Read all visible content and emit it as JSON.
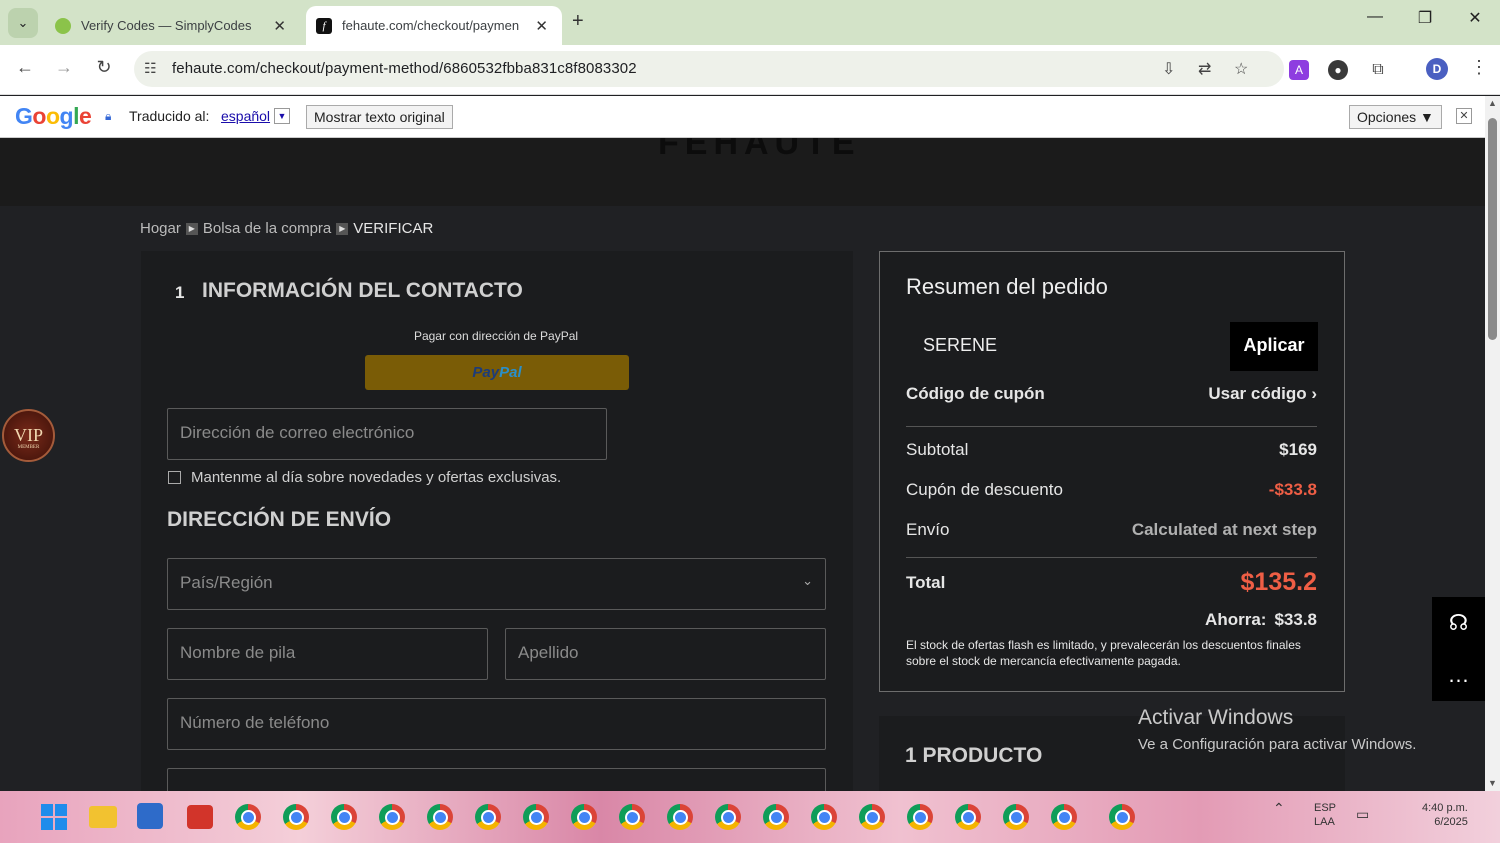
{
  "browser": {
    "tabs": [
      {
        "title": "Verify Codes — SimplyCodes",
        "active": false
      },
      {
        "title": "fehaute.com/checkout/paymen",
        "active": true
      }
    ],
    "url": "fehaute.com/checkout/payment-method/6860532fbba831c8f8083302",
    "profile_initial": "D"
  },
  "translate_bar": {
    "logo": "Google",
    "translated_to_label": "Traducido al:",
    "language": "español",
    "show_original_label": "Mostrar texto original",
    "options_label": "Opciones ▼"
  },
  "page": {
    "brand": "FEHAUTE",
    "breadcrumb": [
      "Hogar",
      "Bolsa de la compra",
      "VERIFICAR"
    ],
    "contact": {
      "step_number": "1",
      "title": "INFORMACIÓN DEL CONTACTO",
      "paypal_label": "Pagar con dirección de PayPal",
      "paypal_button_1": "Pay",
      "paypal_button_2": "Pal",
      "email_placeholder": "Dirección de correo electrónico",
      "newsletter_label": "Mantenme al día sobre novedades y ofertas exclusivas."
    },
    "shipping": {
      "title": "DIRECCIÓN DE ENVÍO",
      "country_placeholder": "País/Región",
      "first_name_placeholder": "Nombre de pila",
      "last_name_placeholder": "Apellido",
      "phone_placeholder": "Número de teléfono"
    },
    "vip_badge": {
      "title": "VIP",
      "subtitle": "MEMBER"
    },
    "summary": {
      "title": "Resumen del pedido",
      "coupon_value": "SERENE",
      "apply_label": "Aplicar",
      "coupon_label": "Código de cupón",
      "use_code_label": "Usar código",
      "subtotal_label": "Subtotal",
      "subtotal_value": "$169",
      "discount_label": "Cupón de descuento",
      "discount_value": "-$33.8",
      "shipping_label": "Envío",
      "shipping_value": "Calculated at next step",
      "total_label": "Total",
      "total_value": "$135.2",
      "savings_label": "Ahorra:",
      "savings_value": "$33.8",
      "notice": "El stock de ofertas flash es limitado, y prevalecerán los descuentos finales sobre el stock de mercancía efectivamente pagada."
    },
    "products": {
      "title": "1 PRODUCTO"
    },
    "windows_watermark": {
      "title": "Activar Windows",
      "subtitle": "Ve a Configuración para activar Windows."
    }
  },
  "taskbar": {
    "lang_1": "ESP",
    "lang_2": "LAA",
    "time": "4:40 p.m.",
    "date": "6/2025"
  },
  "colors": {
    "accent_discount": "#ef5e45",
    "paypal_button": "#7a5c06",
    "tab_bar": "#d3e3c8",
    "page_bg": "#202124"
  }
}
